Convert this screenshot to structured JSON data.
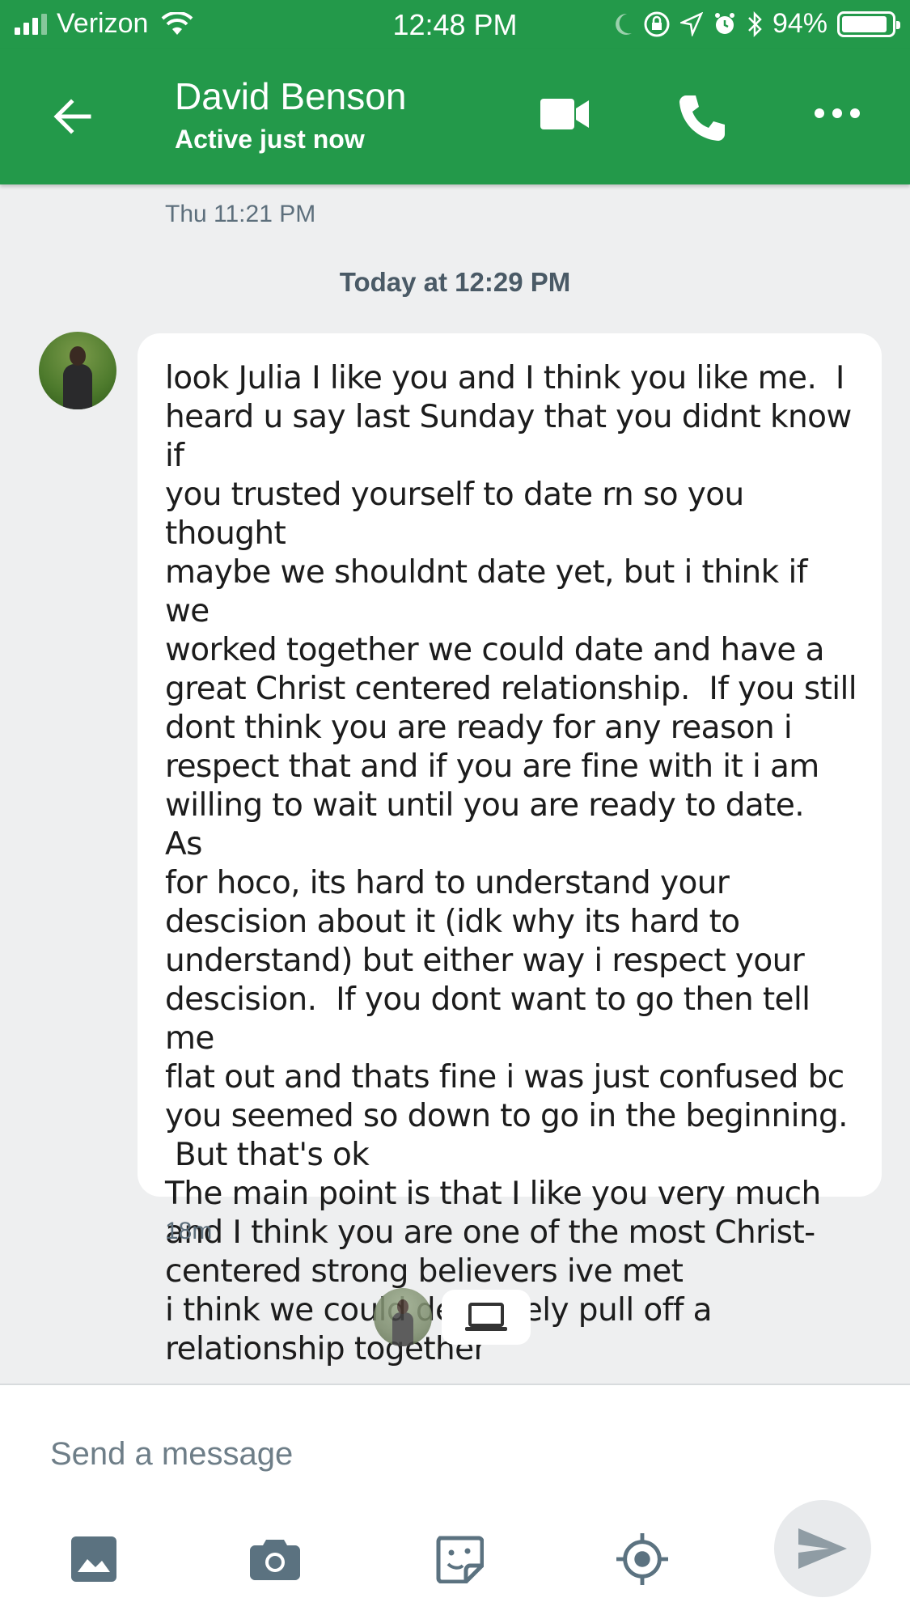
{
  "status_bar": {
    "carrier": "Verizon",
    "time": "12:48 PM",
    "battery_percent": "94%",
    "battery_level": 0.94,
    "signal_bars": 3,
    "icons": [
      "signal-icon",
      "wifi-icon",
      "moon-icon",
      "orientation-lock-icon",
      "location-arrow-icon",
      "alarm-icon",
      "bluetooth-icon",
      "battery-icon"
    ]
  },
  "header": {
    "contact_name": "David Benson",
    "contact_status": "Active just now",
    "icons": [
      "back-arrow-icon",
      "video-camera-icon",
      "phone-icon",
      "more-dots-icon"
    ],
    "accent_color": "#23994a"
  },
  "conversation": {
    "previous_timestamp": "Thu 11:21 PM",
    "date_divider": "Today at 12:29 PM",
    "message": {
      "text": "look Julia I like you and I think you like me.  I\nheard u say last Sunday that you didnt know if\nyou trusted yourself to date rn so you thought\nmaybe we shouldnt date yet, but i think if we\nworked together we could date and have a\ngreat Christ centered relationship.  If you still\ndont think you are ready for any reason i\nrespect that and if you are fine with it i am\nwilling to wait until you are ready to date.  As\nfor hoco, its hard to understand your\ndescision about it (idk why its hard to\nunderstand) but either way i respect your\ndescision.  If you dont want to go then tell me\nflat out and thats fine i was just confused bc\nyou seemed so down to go in the beginning.\n But that's ok\nThe main point is that I like you very much\nand I think you are one of the most Christ-\ncentered strong believers ive met\ni think we could definately pull off a\nrelationship together",
      "time": "18m"
    },
    "read_receipt_icon": "laptop-icon"
  },
  "composer": {
    "placeholder": "Send a message",
    "value": "",
    "tools": [
      "image-icon",
      "camera-icon",
      "sticker-icon",
      "location-icon"
    ],
    "send_icon": "send-icon"
  }
}
